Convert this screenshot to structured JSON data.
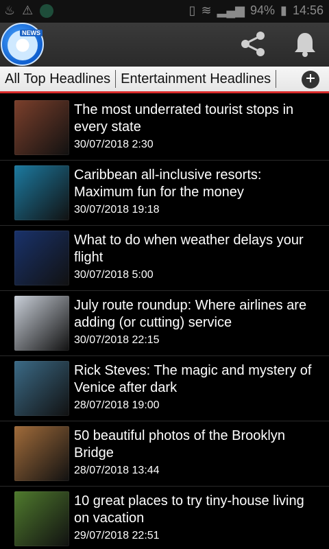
{
  "status": {
    "battery": "94%",
    "time": "14:56"
  },
  "app": {
    "logo_text": "NEWS",
    "icons": [
      "share-icon",
      "bell-icon"
    ]
  },
  "tabs": [
    {
      "label": "All Top Headlines"
    },
    {
      "label": "Entertainment Headlines"
    }
  ],
  "articles": [
    {
      "title": "The most underrated tourist stops in every state",
      "date": "30/07/2018 2:30",
      "thumb_color": "#7b3f2b"
    },
    {
      "title": "Caribbean all-inclusive resorts: Maximum fun for the money",
      "date": "30/07/2018 19:18",
      "thumb_color": "#1c7aa0"
    },
    {
      "title": "What to do when weather delays your flight",
      "date": "30/07/2018 5:00",
      "thumb_color": "#19326b"
    },
    {
      "title": "July route roundup: Where airlines are adding (or cutting) service",
      "date": "30/07/2018 22:15",
      "thumb_color": "#c9cfd8"
    },
    {
      "title": "Rick Steves: The magic and mystery of Venice after dark",
      "date": "28/07/2018 19:00",
      "thumb_color": "#3b6a86"
    },
    {
      "title": "50 beautiful photos of the Brooklyn Bridge",
      "date": "28/07/2018 13:44",
      "thumb_color": "#a06b3a"
    },
    {
      "title": "10 great places to try tiny-house living on vacation",
      "date": "29/07/2018 22:51",
      "thumb_color": "#4f7a2d"
    }
  ]
}
